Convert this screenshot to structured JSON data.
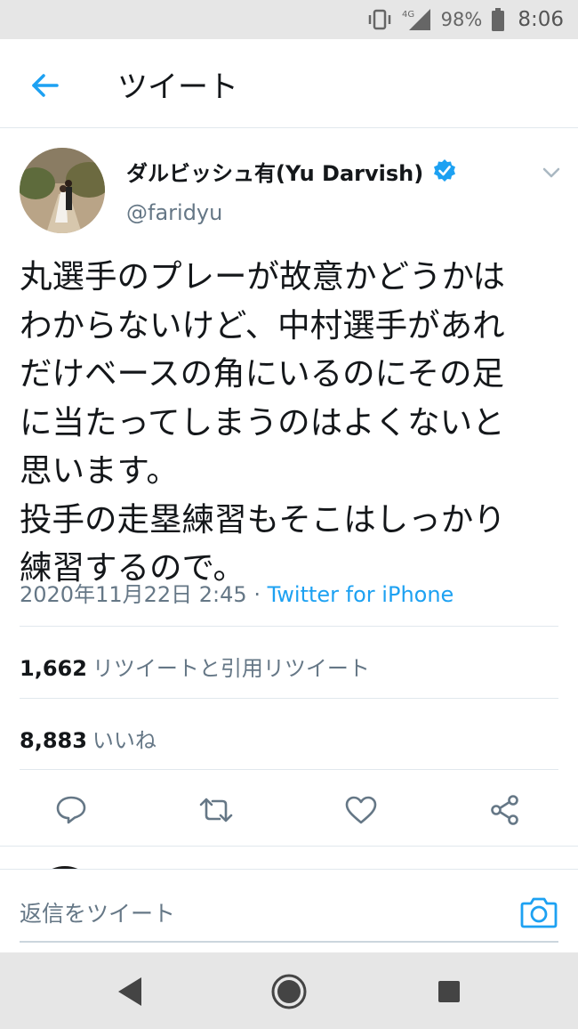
{
  "status_bar": {
    "network": "4G",
    "battery": "98%",
    "time": "8:06",
    "icons": [
      "vibrate-icon",
      "signal-icon",
      "battery-icon"
    ]
  },
  "header": {
    "title": "ツイート",
    "back_icon": "back-arrow-icon"
  },
  "tweet": {
    "author_name": "ダルビッシュ有(Yu Darvish)",
    "handle": "@faridyu",
    "verified": true,
    "text": "丸選手のプレーが故意かどうかは\nわからないけど、中村選手があれ\nだけベースの角にいるのにその足\nに当たってしまうのはよくないと\n思います。\n投手の走塁練習もそこはしっかり\n練習するので。",
    "date": "2020年11月22日 2:45",
    "separator": "·",
    "source": "Twitter for iPhone",
    "retweets": {
      "count": "1,662",
      "label": "リツイートと引用リツイート"
    },
    "likes": {
      "count": "8,883",
      "label": "いいね"
    },
    "actions": [
      "reply-icon",
      "retweet-icon",
      "like-icon",
      "share-icon"
    ]
  },
  "reply": {
    "placeholder": "返信をツイート",
    "camera_icon": "camera-icon"
  },
  "colors": {
    "accent": "#1da1f2",
    "secondary_text": "#657786",
    "divider": "#e1e8ed",
    "system_bar": "#e6e6e6"
  },
  "nav_bar": {
    "buttons": [
      "back-triangle-icon",
      "home-circle-icon",
      "recents-square-icon"
    ]
  }
}
